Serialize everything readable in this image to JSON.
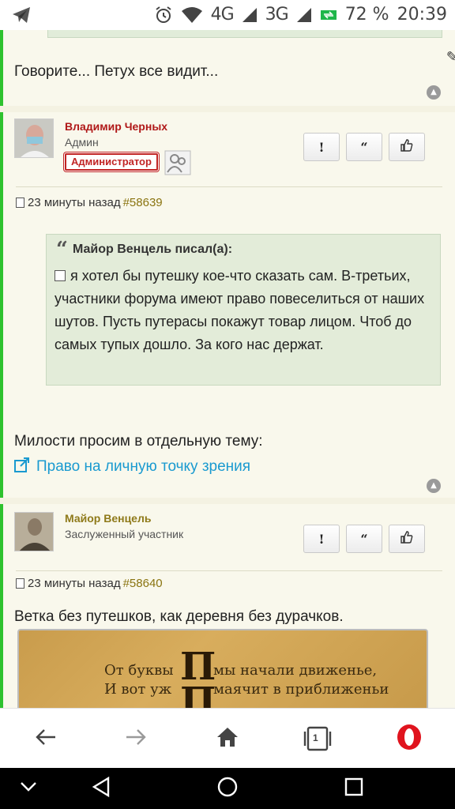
{
  "status_bar": {
    "network_4g": "4G",
    "network_3g": "3G",
    "battery": "72 %",
    "time": "20:39",
    "icons": [
      "telegram-icon",
      "alarm-icon",
      "wifi-icon",
      "signal-icon",
      "battery-icon"
    ]
  },
  "post_prev": {
    "text": "Говорите... Петух все видит..."
  },
  "post_1": {
    "author": "Владимир Черных",
    "role": "Админ",
    "badge": "Администратор",
    "time": "23 минуты назад",
    "post_id": "#58639",
    "actions": [
      "!",
      "“",
      "like"
    ],
    "quote_author": "Майор Венцель писал(а):",
    "quote_text": "я хотел бы путешку кое-что сказать сам. В-третьих, участники форума имеют право повеселиться от наших шутов. Пусть путерасы покажут товар лицом. Чтоб до самых тупых дошло. За кого нас держат.",
    "text": "Милости просим в отдельную тему:",
    "link": "Право на личную точку зрения"
  },
  "post_2": {
    "author": "Майор Венцель",
    "role": "Заслуженный участник",
    "time": "23 минуты назад",
    "post_id": "#58640",
    "text": "Ветка без путешков, как деревня без дурачков.",
    "poster_line_1a": "От буквы",
    "poster_line_1b": "мы начали движенье,",
    "poster_line_2a": "И вот уж",
    "poster_line_2b": "маячит в приближеньи",
    "poster_letter": "П"
  },
  "browser": {
    "tab_count": "1"
  },
  "colors": {
    "accent_green": "#2ec22e",
    "admin_red": "#b01818",
    "author_olive": "#8f7a1a",
    "link_blue": "#1a9ad0",
    "opera_red": "#e0141e"
  }
}
